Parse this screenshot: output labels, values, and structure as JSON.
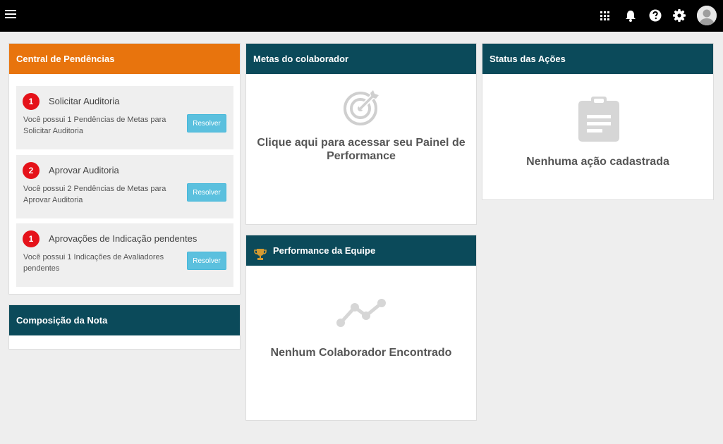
{
  "topbar": {
    "icons": [
      "menu-icon",
      "apps-grid-icon",
      "bell-icon",
      "help-icon",
      "gear-icon",
      "user-avatar"
    ]
  },
  "central": {
    "title": "Central de Pendências",
    "items": [
      {
        "number": "1",
        "title": "Solicitar Auditoria",
        "description": "Você possui 1 Pendências de Metas para Solicitar Auditoria",
        "button": "Resolver"
      },
      {
        "number": "2",
        "title": "Aprovar Auditoria",
        "description": "Você possui 2 Pendências de Metas para Aprovar Auditoria",
        "button": "Resolver"
      },
      {
        "number": "1",
        "title": "Aprovações de Indicação pendentes",
        "description": "Você possui 1 Indicações de Avaliadores pendentes",
        "button": "Resolver"
      }
    ]
  },
  "composicao": {
    "title": "Composição da Nota"
  },
  "metas": {
    "title": "Metas do colaborador",
    "message": "Clique aqui para acessar seu Painel de Performance"
  },
  "performance": {
    "title": "Performance da Equipe",
    "message": "Nenhum Colaborador Encontrado"
  },
  "status": {
    "title": "Status das Ações",
    "message": "Nenhuma ação cadastrada"
  },
  "colors": {
    "topbar": "#000000",
    "header_teal": "#0b4a5a",
    "header_orange": "#e8740d",
    "badge_red": "#e5121a",
    "button": "#5bc0de",
    "background": "#eeeeee"
  }
}
